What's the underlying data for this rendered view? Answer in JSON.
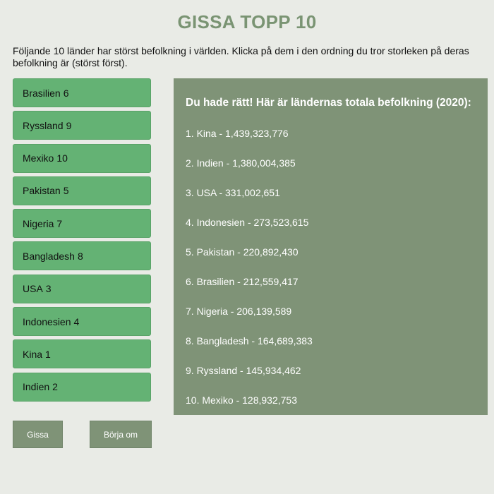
{
  "title": "GISSA TOPP 10",
  "intro": "Följande 10 länder har störst befolkning i världen. Klicka på dem i den ordning du tror storleken på deras befolkning är (störst först).",
  "countries": [
    {
      "name": "Brasilien",
      "rank": "6"
    },
    {
      "name": "Ryssland",
      "rank": "9"
    },
    {
      "name": "Mexiko",
      "rank": "10"
    },
    {
      "name": "Pakistan",
      "rank": "5"
    },
    {
      "name": "Nigeria",
      "rank": "7"
    },
    {
      "name": "Bangladesh",
      "rank": "8"
    },
    {
      "name": "USA",
      "rank": "3"
    },
    {
      "name": "Indonesien",
      "rank": "4"
    },
    {
      "name": "Kina",
      "rank": "1"
    },
    {
      "name": "Indien",
      "rank": "2"
    }
  ],
  "result": {
    "heading": "Du hade rätt! Här är ländernas totala befolkning (2020):",
    "items": [
      "1. Kina - 1,439,323,776",
      "2. Indien - 1,380,004,385",
      "3. USA - 331,002,651",
      "4. Indonesien - 273,523,615",
      "5. Pakistan - 220,892,430",
      "6. Brasilien - 212,559,417",
      "7. Nigeria - 206,139,589",
      "8. Bangladesh - 164,689,383",
      "9. Ryssland - 145,934,462",
      "10. Mexiko - 128,932,753"
    ]
  },
  "buttons": {
    "guess": "Gissa",
    "restart": "Börja om"
  },
  "colors": {
    "background": "#e9ebe6",
    "title": "#7a9473",
    "country_button": "#64b274",
    "panel": "#7f9377",
    "action_button": "#7f9377"
  }
}
